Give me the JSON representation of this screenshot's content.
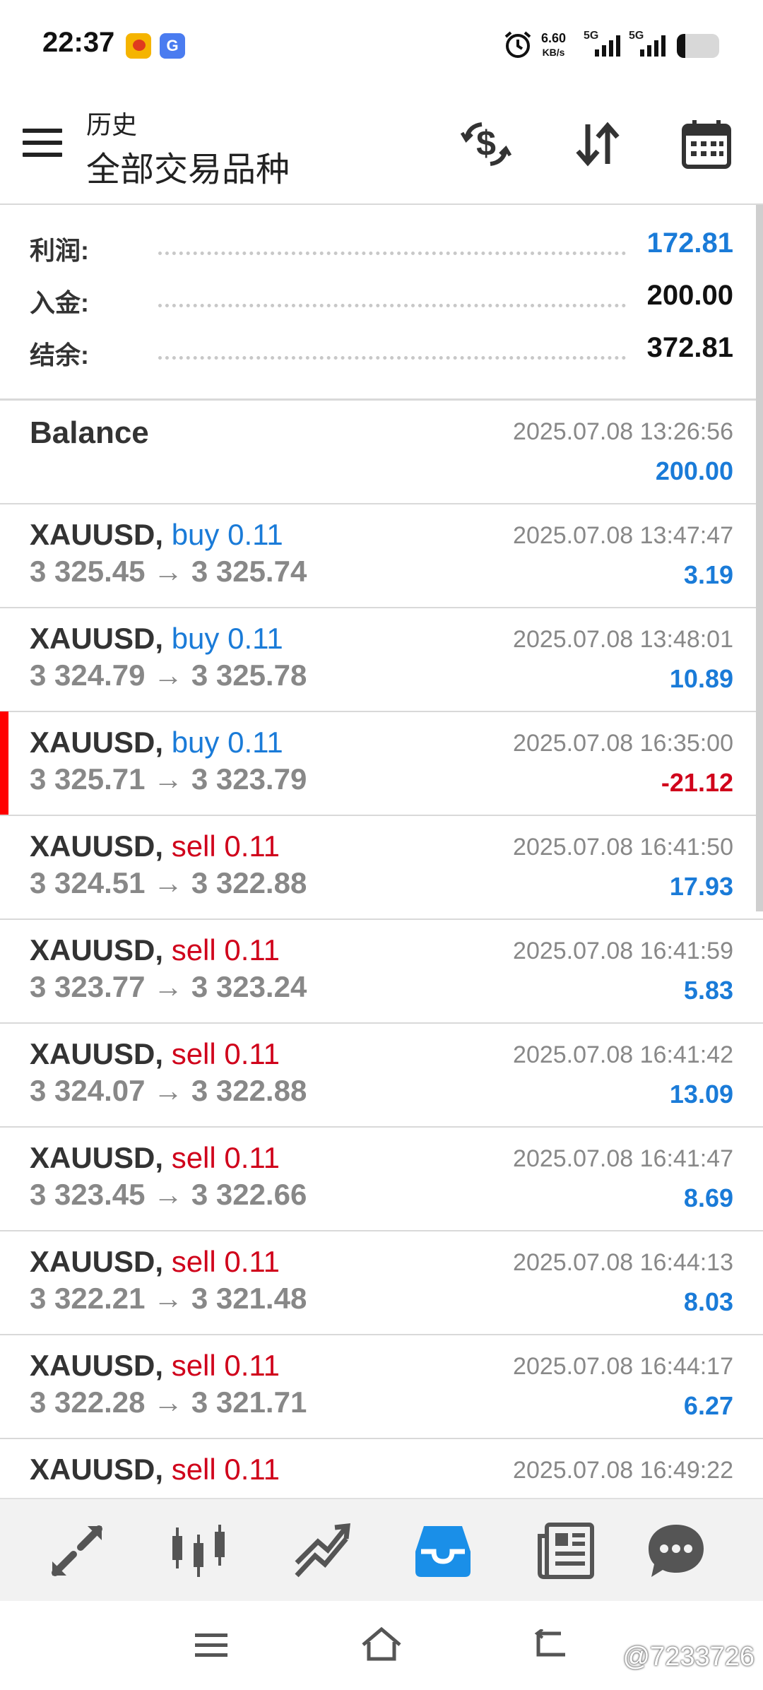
{
  "status_bar": {
    "time": "22:37",
    "net_speed_value": "6.60",
    "net_speed_unit": "KB/s",
    "sim1_label": "5G",
    "sim2_label": "5G",
    "app2_glyph": "G"
  },
  "header": {
    "subtitle": "历史",
    "title": "全部交易品种",
    "icons": [
      "currency-exchange-icon",
      "sort-icon",
      "calendar-icon"
    ]
  },
  "summary": [
    {
      "label": "利润:",
      "value": "172.81",
      "color": "#1a7bd8"
    },
    {
      "label": "入金:",
      "value": "200.00",
      "color": "#111111"
    },
    {
      "label": "结余:",
      "value": "372.81",
      "color": "#111111"
    }
  ],
  "balance": {
    "title": "Balance",
    "datetime": "2025.07.08 13:26:56",
    "amount": "200.00"
  },
  "trades": [
    {
      "symbol": "XAUUSD,",
      "type": "buy 0.11",
      "side": "buy",
      "prices": "3 325.45 → 3 325.74",
      "datetime": "2025.07.08 13:47:47",
      "profit": "3.19",
      "negative": false
    },
    {
      "symbol": "XAUUSD,",
      "type": "buy 0.11",
      "side": "buy",
      "prices": "3 324.79 → 3 325.78",
      "datetime": "2025.07.08 13:48:01",
      "profit": "10.89",
      "negative": false
    },
    {
      "symbol": "XAUUSD,",
      "type": "buy 0.11",
      "side": "buy",
      "prices": "3 325.71 → 3 323.79",
      "datetime": "2025.07.08 16:35:00",
      "profit": "-21.12",
      "negative": true,
      "marked": true
    },
    {
      "symbol": "XAUUSD,",
      "type": "sell 0.11",
      "side": "sell",
      "prices": "3 324.51 → 3 322.88",
      "datetime": "2025.07.08 16:41:50",
      "profit": "17.93",
      "negative": false
    },
    {
      "symbol": "XAUUSD,",
      "type": "sell 0.11",
      "side": "sell",
      "prices": "3 323.77 → 3 323.24",
      "datetime": "2025.07.08 16:41:59",
      "profit": "5.83",
      "negative": false
    },
    {
      "symbol": "XAUUSD,",
      "type": "sell 0.11",
      "side": "sell",
      "prices": "3 324.07 → 3 322.88",
      "datetime": "2025.07.08 16:41:42",
      "profit": "13.09",
      "negative": false
    },
    {
      "symbol": "XAUUSD,",
      "type": "sell 0.11",
      "side": "sell",
      "prices": "3 323.45 → 3 322.66",
      "datetime": "2025.07.08 16:41:47",
      "profit": "8.69",
      "negative": false
    },
    {
      "symbol": "XAUUSD,",
      "type": "sell 0.11",
      "side": "sell",
      "prices": "3 322.21 → 3 321.48",
      "datetime": "2025.07.08 16:44:13",
      "profit": "8.03",
      "negative": false
    },
    {
      "symbol": "XAUUSD,",
      "type": "sell 0.11",
      "side": "sell",
      "prices": "3 322.28 → 3 321.71",
      "datetime": "2025.07.08 16:44:17",
      "profit": "6.27",
      "negative": false
    },
    {
      "symbol": "XAUUSD,",
      "type": "sell 0.11",
      "side": "sell",
      "prices": "",
      "datetime": "2025.07.08 16:49:22",
      "profit": "",
      "negative": false
    }
  ],
  "colors": {
    "buy": "#1a7bd8",
    "sell": "#d0021b",
    "positive_profit": "#1a7bd8",
    "negative_profit": "#d0021b",
    "active_nav": "#1a8fe8",
    "nav_icon": "#555555"
  },
  "bottom_nav": [
    {
      "icon": "quotes-icon",
      "active": false
    },
    {
      "icon": "chart-icon",
      "active": false
    },
    {
      "icon": "trade-icon",
      "active": false
    },
    {
      "icon": "history-icon",
      "active": true
    },
    {
      "icon": "news-icon",
      "active": false
    },
    {
      "icon": "messages-icon",
      "active": false
    }
  ],
  "system_nav": [
    "menu-icon",
    "home-icon",
    "back-icon"
  ],
  "watermark": "@7233726"
}
